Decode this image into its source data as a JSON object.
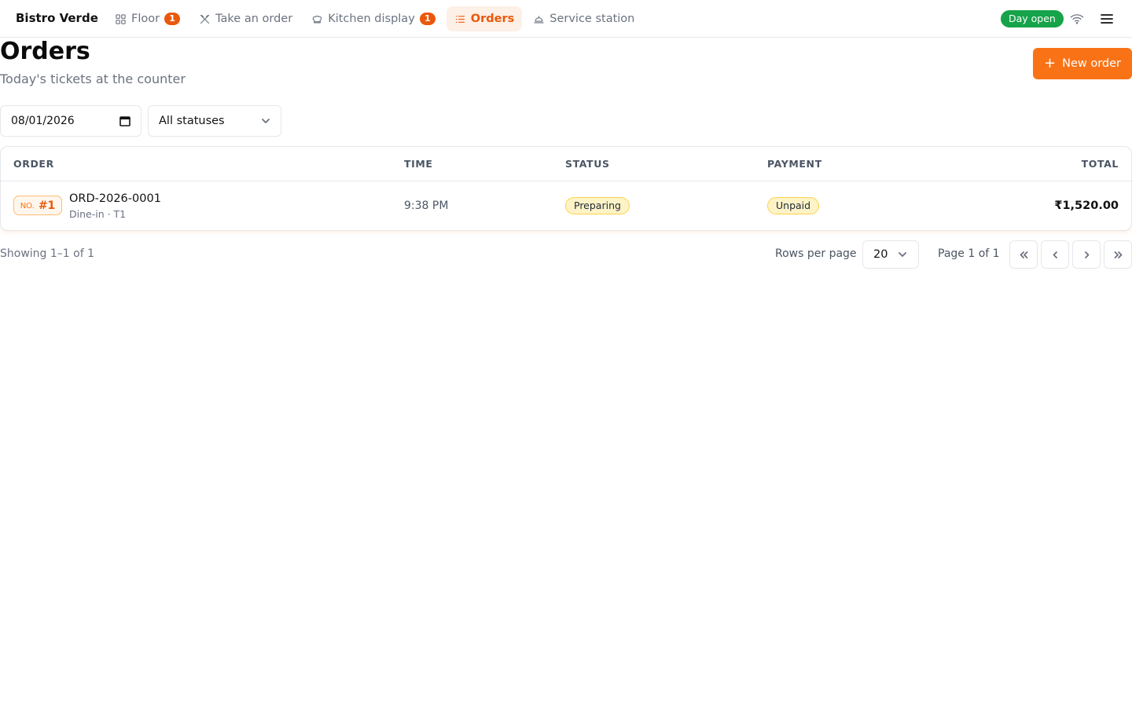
{
  "app": {
    "brand": "Bistro Verde",
    "accent_color": "#f97316",
    "day_status": "Day open",
    "day_status_color": "#16a34a"
  },
  "nav": [
    {
      "label": "Floor",
      "icon": "grid-icon",
      "badge": "1",
      "active": false
    },
    {
      "label": "Take an order",
      "icon": "utensils-icon",
      "badge": "",
      "active": false
    },
    {
      "label": "Kitchen display",
      "icon": "chef-hat-icon",
      "badge": "1",
      "active": false
    },
    {
      "label": "Orders",
      "icon": "list-icon",
      "badge": "",
      "active": true
    },
    {
      "label": "Service station",
      "icon": "cloche-icon",
      "badge": "",
      "active": false
    }
  ],
  "header": {
    "title": "Orders",
    "subtitle": "Today's tickets at the counter",
    "new_order_label": "New order"
  },
  "filters": {
    "date_value": "08/01/2026",
    "status_value": "All statuses"
  },
  "table": {
    "columns": {
      "order": "ORDER",
      "time": "TIME",
      "status": "STATUS",
      "payment": "PAYMENT",
      "total": "TOTAL"
    },
    "rows": [
      {
        "no_label": "NO.",
        "number": "#1",
        "order_id": "ORD-2026-0001",
        "meta": "Dine-in · T1",
        "time": "9:38 PM",
        "status": "Preparing",
        "payment": "Unpaid",
        "total": "₹1,520.00"
      }
    ]
  },
  "pagination": {
    "showing": "Showing 1–1 of 1",
    "rows_per_page_label": "Rows per page",
    "rows_per_page": "20",
    "page_label": "Page 1 of 1"
  }
}
